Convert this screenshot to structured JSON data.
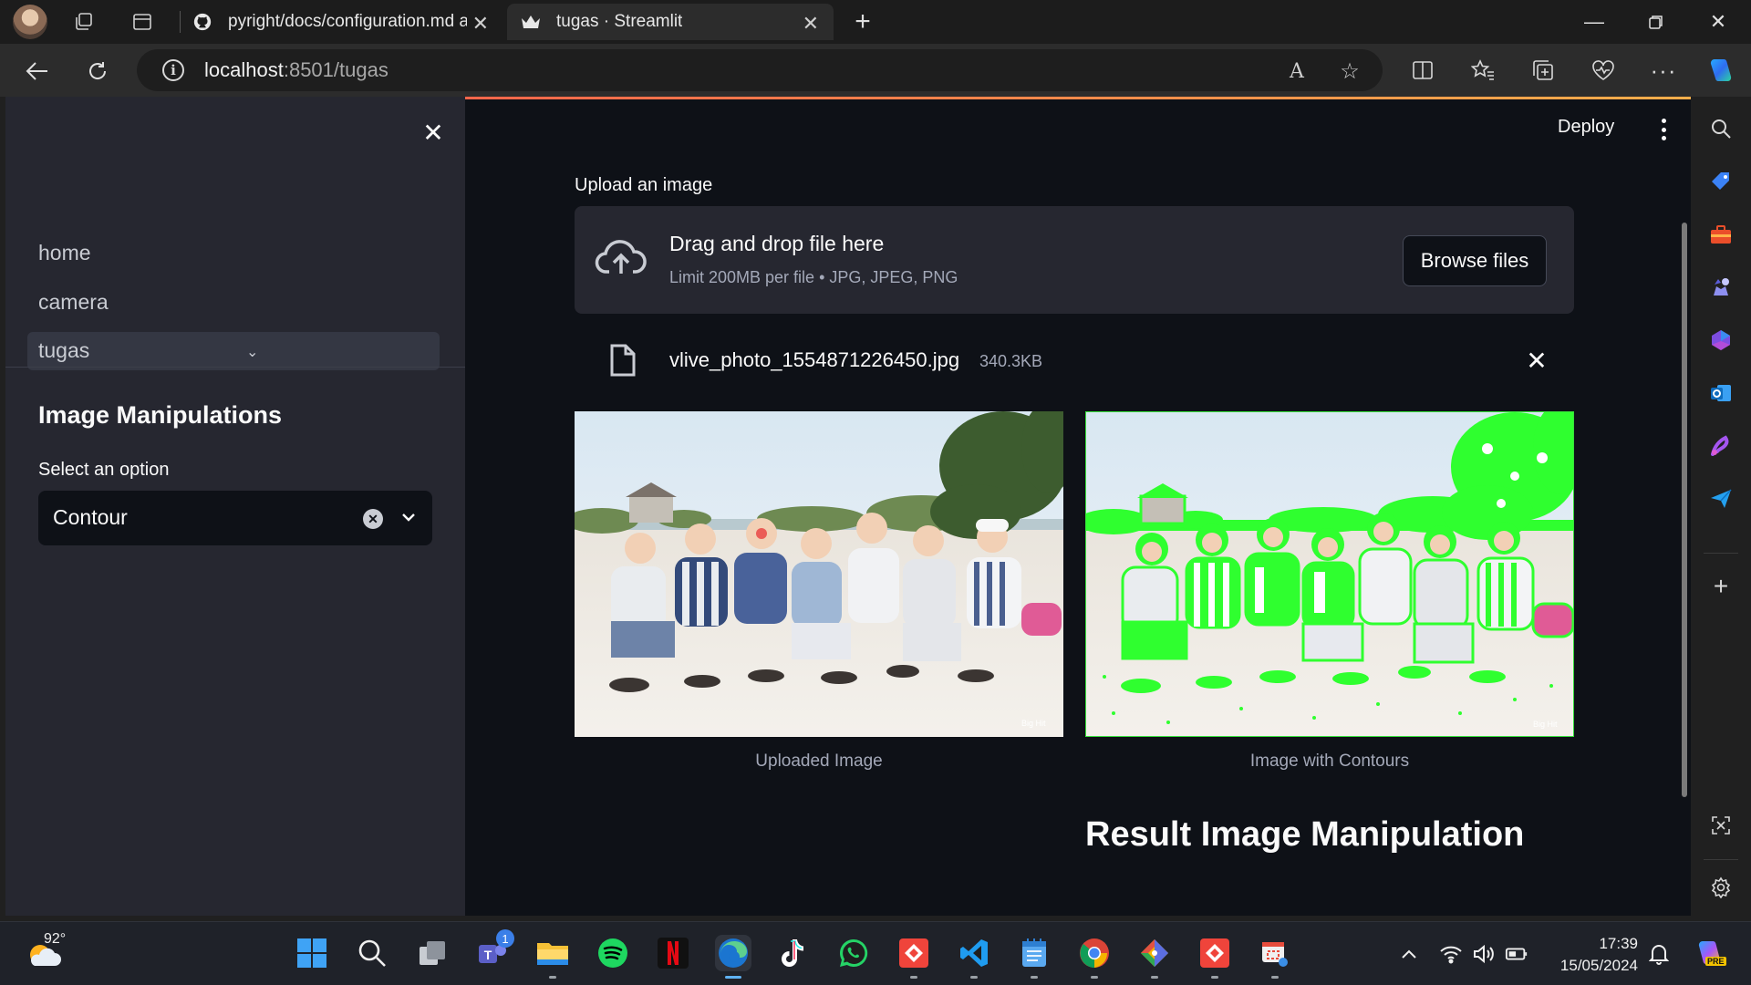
{
  "browser": {
    "tabs": [
      {
        "title": "pyright/docs/configuration.md at m"
      },
      {
        "title": "tugas · Streamlit"
      }
    ],
    "url_host": "localhost",
    "url_path": ":8501/tugas",
    "read_aloud_label": "A",
    "edge_logo_colors": [
      "#1b75d0",
      "#5ecf8e"
    ]
  },
  "sidebar": {
    "nav_items": [
      {
        "label": "home"
      },
      {
        "label": "camera"
      },
      {
        "label": "tugas"
      }
    ],
    "heading": "Image Manipulations",
    "select_label": "Select an option",
    "select_value": "Contour"
  },
  "header": {
    "deploy_label": "Deploy"
  },
  "uploader": {
    "label": "Upload an image",
    "drop_title": "Drag and drop file here",
    "drop_limit": "Limit 200MB per file • JPG, JPEG, PNG",
    "browse_label": "Browse files",
    "file_name": "vlive_photo_1554871226450.jpg",
    "file_size": "340.3KB"
  },
  "images": {
    "left_caption": "Uploaded Image",
    "right_caption": "Image with Contours",
    "watermark": "Big Hit",
    "contour_color": "#2fff2f"
  },
  "result": {
    "title": "Result Image Manipulation"
  },
  "taskbar": {
    "weather_temp": "92°",
    "teams_badge": "1",
    "time": "17:39",
    "date": "15/05/2024",
    "copilot_badge": "PRE",
    "apps": [
      "windows-start",
      "search",
      "task-view",
      "teams",
      "file-explorer",
      "spotify",
      "netflix",
      "edge",
      "tiktok",
      "whatsapp",
      "anydesk",
      "vscode",
      "notepad",
      "chrome",
      "git",
      "anydesk-2",
      "snipping-tool"
    ]
  },
  "colors": {
    "app_bg": "#0e1117",
    "sidebar_bg": "#262730",
    "accent_gradient_start": "#ff4b4b",
    "accent_gradient_end": "#fdae4b"
  }
}
